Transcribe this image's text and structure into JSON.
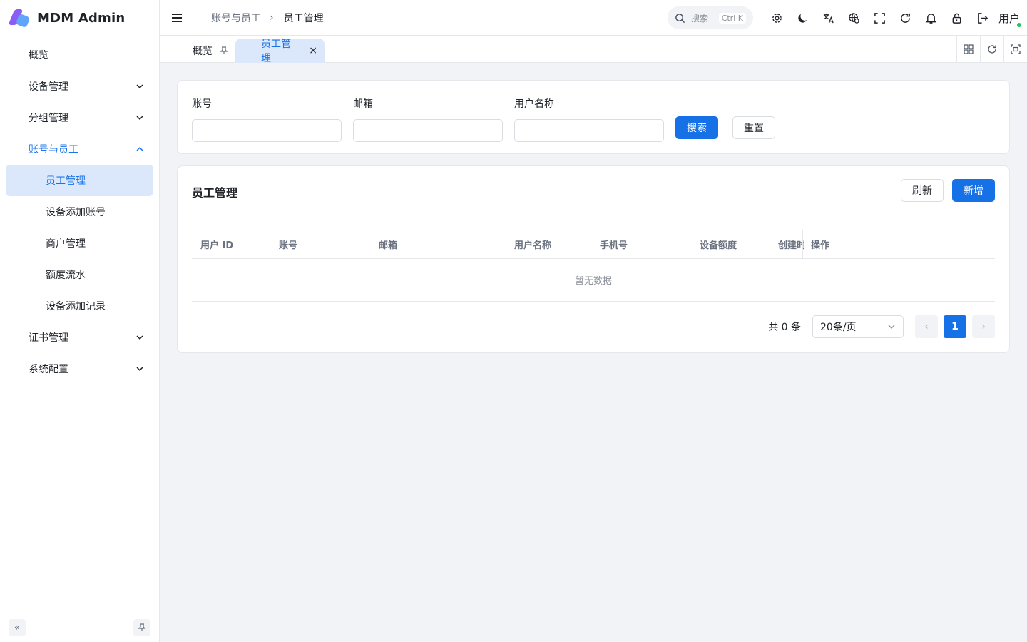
{
  "app": {
    "title": "MDM Admin"
  },
  "sidebar": {
    "items": [
      {
        "label": "概览"
      },
      {
        "label": "设备管理"
      },
      {
        "label": "分组管理"
      },
      {
        "label": "账号与员工"
      },
      {
        "label": "证书管理"
      },
      {
        "label": "系统配置"
      }
    ],
    "subitems": [
      {
        "label": "员工管理"
      },
      {
        "label": "设备添加账号"
      },
      {
        "label": "商户管理"
      },
      {
        "label": "额度流水"
      },
      {
        "label": "设备添加记录"
      }
    ],
    "collapse_icon": "double-chevron-left-icon",
    "pin_icon": "pin-icon"
  },
  "header": {
    "breadcrumb": {
      "parent": "账号与员工",
      "current": "员工管理"
    },
    "search": {
      "placeholder": "搜索",
      "shortcut": "Ctrl K"
    },
    "user_label": "用户",
    "icons": [
      "settings-icon",
      "moon-icon",
      "translate-icon",
      "globe-icon",
      "fullscreen-icon",
      "refresh-icon",
      "bell-icon",
      "lock-icon",
      "logout-icon"
    ]
  },
  "tabs": [
    {
      "label": "概览"
    },
    {
      "label": "员工管理"
    }
  ],
  "filter": {
    "fields": [
      {
        "label": "账号",
        "value": ""
      },
      {
        "label": "邮箱",
        "value": ""
      },
      {
        "label": "用户名称",
        "value": ""
      }
    ],
    "search_label": "搜索",
    "reset_label": "重置"
  },
  "table": {
    "title": "员工管理",
    "refresh_label": "刷新",
    "add_label": "新增",
    "columns": [
      "用户 ID",
      "账号",
      "邮箱",
      "用户名称",
      "手机号",
      "设备额度",
      "创建时间",
      "操作"
    ],
    "empty_text": "暂无数据",
    "pagination": {
      "total_text": "共 0 条",
      "page_size": "20条/页",
      "current_page": "1"
    }
  },
  "colors": {
    "primary": "#1670e6",
    "active_bg": "#dbe8fb",
    "active_text": "#1a73e8"
  }
}
